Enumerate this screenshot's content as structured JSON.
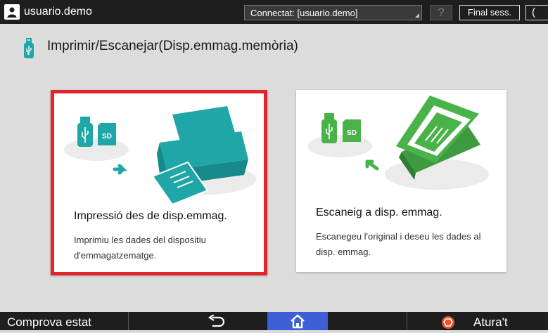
{
  "topbar": {
    "user_label": "usuario.demo",
    "connection_text": "Connectat: [usuario.demo]",
    "help_label": "?",
    "logout_label": "Final sess.",
    "edge_label": "("
  },
  "header": {
    "title": "Imprimir/Escanejar(Disp.emmag.memòria)"
  },
  "cards": [
    {
      "title": "Impressió des de disp.emmag.",
      "description": "Imprimiu les dades del dispositiu d'emmagatzematge.",
      "accent_color": "#1fa6a6",
      "selected": true,
      "sd_label": "SD"
    },
    {
      "title": "Escaneig a disp. emmag.",
      "description": "Escanegeu l'original i deseu les dades al disp. emmag.",
      "accent_color": "#49b34a",
      "selected": false,
      "sd_label": "SD"
    }
  ],
  "bottombar": {
    "check_status_label": "Comprova estat",
    "stop_label": "Atura't"
  },
  "colors": {
    "selection_border": "#e0262a",
    "home_button": "#3f5fd6",
    "stop_icon": "#e8522d"
  },
  "icons": [
    "user-icon",
    "usb-icon",
    "printer-icon",
    "scanner-icon",
    "back-arrow-icon",
    "home-icon",
    "stop-icon"
  ]
}
